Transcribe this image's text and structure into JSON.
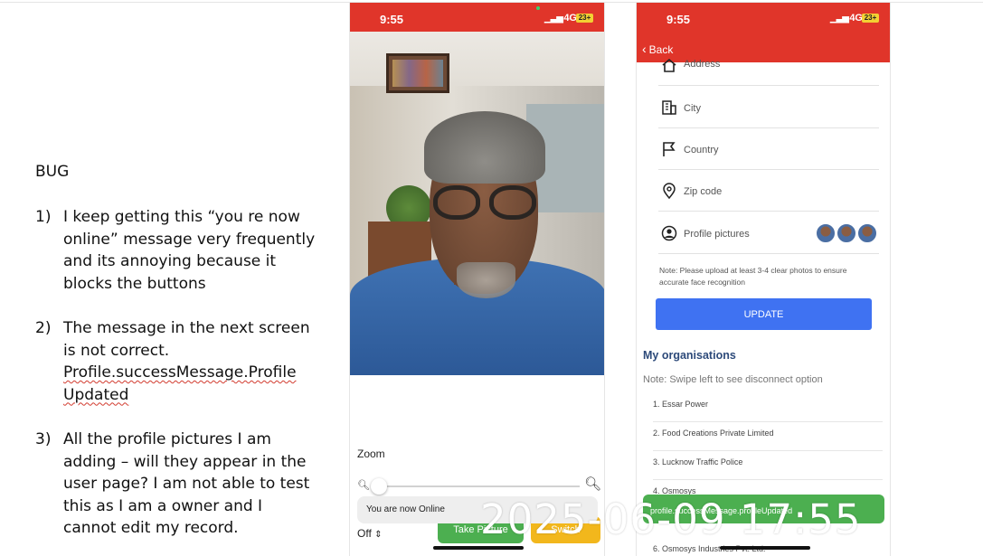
{
  "notes": {
    "heading": "BUG",
    "items": [
      {
        "num": "1)",
        "text": "I keep getting this “you re now online” message very frequently and its annoying because it blocks the buttons"
      },
      {
        "num": "2)",
        "text_prefix": "The message in the next screen is not correct.",
        "text_squiggle": "Profile.successMessage.Profile Updated"
      },
      {
        "num": "3)",
        "text": "All the profile pictures I am adding – will they appear in the user page? I am not able to test this as I am a owner and I cannot edit my record."
      }
    ]
  },
  "phone1": {
    "status": {
      "time": "9:55",
      "network": "4G",
      "battery": "23+"
    },
    "zoom_label": "Zoom",
    "zoom_level": 0.0,
    "toast": "You are now Online",
    "flash_select": "Off",
    "take_picture": "Take Picture",
    "switch": "Switch"
  },
  "phone2": {
    "status": {
      "time": "9:55",
      "network": "4G",
      "battery": "23+"
    },
    "back": "Back",
    "fields": [
      {
        "icon": "home-icon",
        "label": "Address"
      },
      {
        "icon": "building-icon",
        "label": "City"
      },
      {
        "icon": "flag-icon",
        "label": "Country"
      },
      {
        "icon": "location-pin-icon",
        "label": "Zip code"
      },
      {
        "icon": "user-circle-icon",
        "label": "Profile pictures"
      }
    ],
    "note": "Note: Please upload at least 3-4 clear photos to ensure accurate face recognition",
    "update_button": "UPDATE",
    "organisations": {
      "title": "My organisations",
      "hint": "Note: Swipe left to see disconnect option",
      "items": [
        "1. Essar Power",
        "2. Food Creations Private Limited",
        "3. Lucknow Traffic Police",
        "4. Osmosys",
        "6. Osmosys Industries Pvt. Ltd."
      ]
    },
    "toast": "profile.successMessage.profileUpdated"
  },
  "timestamp": "2025-06-09 17:55",
  "colors": {
    "status_bar": "#e0352a",
    "update_button": "#3f72f2",
    "toast_green": "#4caf50",
    "switch_yellow": "#f2b71c"
  }
}
